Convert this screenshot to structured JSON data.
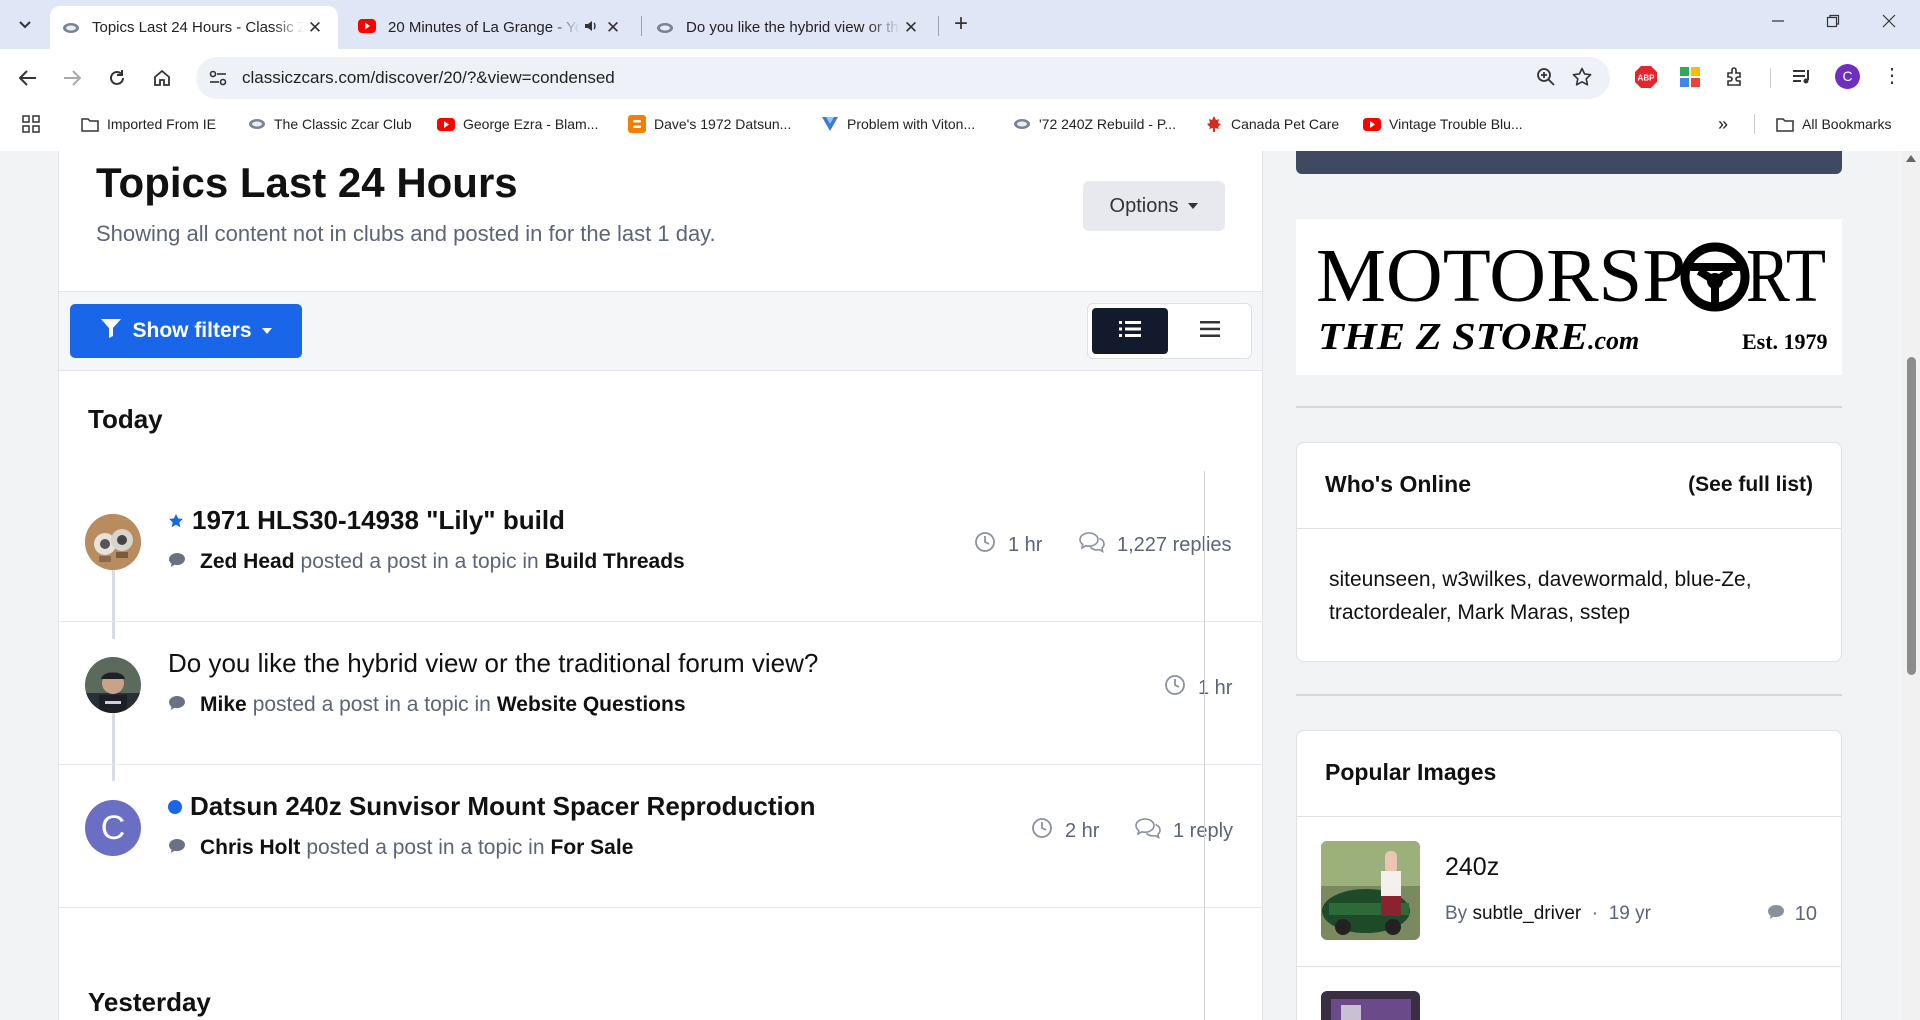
{
  "browser": {
    "tabs": [
      {
        "title": "Topics Last 24 Hours - Classic Zcar Club",
        "active": true
      },
      {
        "title": "20 Minutes of La Grange - YouTube",
        "active": false
      },
      {
        "title": "Do you like the hybrid view or the traditional forum view?",
        "active": false
      }
    ],
    "url": "classiczcars.com/discover/20/?&view=condensed",
    "profile_initial": "C",
    "ext_abp": "ABP",
    "bookmarks": [
      "Imported From IE",
      "The Classic Zcar Club",
      "George Ezra - Blam...",
      "Dave's 1972 Datsun...",
      "Problem with Viton...",
      "'72 240Z Rebuild - P...",
      "Canada Pet Care",
      "Vintage Trouble Blu..."
    ],
    "all_bookmarks": "All Bookmarks"
  },
  "page": {
    "title": "Topics Last 24 Hours",
    "subtitle": "Showing all content not in clubs and posted in for the last 1 day.",
    "options_label": "Options",
    "show_filters_label": "Show filters",
    "today_label": "Today",
    "yesterday_label": "Yesterday",
    "posted_text": "posted a post in a topic in",
    "topics": [
      {
        "title": "1971 HLS30-14938 \"Lily\" build",
        "author": "Zed Head",
        "forum": "Build Threads",
        "time": "1 hr",
        "replies": "1,227 replies"
      },
      {
        "title": "Do you like the hybrid view or the traditional forum view?",
        "author": "Mike",
        "forum": "Website Questions",
        "time": "1 hr",
        "replies": ""
      },
      {
        "title": "Datsun 240z Sunvisor Mount Spacer Reproduction",
        "author": "Chris Holt",
        "forum": "For Sale",
        "time": "2 hr",
        "replies": "1 reply",
        "avatar_initial": "C"
      }
    ]
  },
  "sidebar": {
    "ad": {
      "line1": "MOTORSP",
      "line1b": "RT",
      "line2": "THE Z STORE",
      "line2b": ".com",
      "est": "Est. 1979"
    },
    "whos_online": {
      "title": "Who's Online",
      "link": "(See full list)",
      "users": "siteunseen, w3wilkes, davewormald, blue-Ze, tractordealer, Mark Maras, sstep"
    },
    "popular_images": {
      "title": "Popular Images",
      "items": [
        {
          "title": "240z",
          "by": "By",
          "author": "subtle_driver",
          "age": "19 yr",
          "comments": "10"
        }
      ]
    }
  },
  "colors": {
    "accent": "#1a66e8",
    "dark": "#121a2c",
    "muted": "#5c6478"
  }
}
